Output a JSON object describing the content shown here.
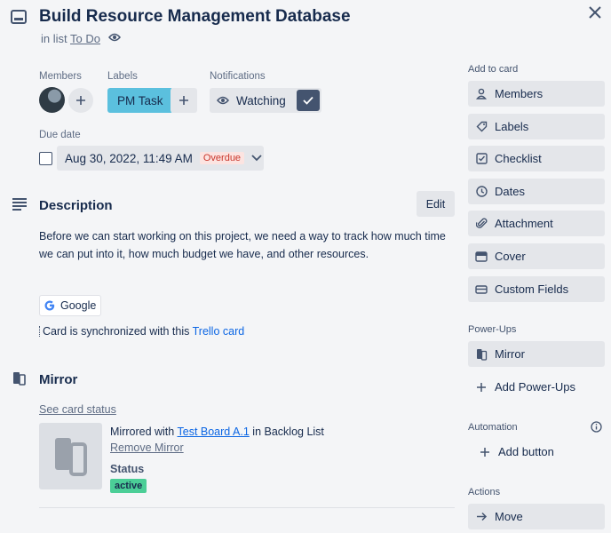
{
  "card": {
    "title": "Build Resource Management Database",
    "in_list_prefix": "in list",
    "list_name": "To Do"
  },
  "members": {
    "heading": "Members"
  },
  "labels": {
    "heading": "Labels",
    "items": [
      {
        "name": "PM Task",
        "color": "#5bc0de"
      }
    ]
  },
  "notifications": {
    "heading": "Notifications",
    "watch_label": "Watching"
  },
  "due_date": {
    "heading": "Due date",
    "value": "Aug 30, 2022, 11:49 AM",
    "status": "Overdue"
  },
  "description": {
    "heading": "Description",
    "edit_label": "Edit",
    "text": "Before we can start working on this project, we need a way to track how much time we can put into it, how much budget we have, and other resources."
  },
  "google_chip": {
    "label": "Google"
  },
  "sync": {
    "prefix": "Card is synchronized with this",
    "link": "Trello card"
  },
  "mirror": {
    "heading": "Mirror",
    "see_status": "See card status",
    "mirrored_prefix": "Mirrored with",
    "board_link": "Test Board A.1",
    "mirrored_suffix": "in Backlog List",
    "remove_label": "Remove Mirror",
    "status_heading": "Status",
    "status_value": "active"
  },
  "sidebar": {
    "add_to_card_heading": "Add to card",
    "add_to_card": [
      {
        "label": "Members",
        "icon": "person-icon"
      },
      {
        "label": "Labels",
        "icon": "tag-icon"
      },
      {
        "label": "Checklist",
        "icon": "checkbox-icon"
      },
      {
        "label": "Dates",
        "icon": "clock-icon"
      },
      {
        "label": "Attachment",
        "icon": "paperclip-icon"
      },
      {
        "label": "Cover",
        "icon": "card-icon"
      },
      {
        "label": "Custom Fields",
        "icon": "field-icon"
      }
    ],
    "powerups_heading": "Power-Ups",
    "powerups": [
      {
        "label": "Mirror",
        "icon": "mirror-icon"
      }
    ],
    "add_powerups_label": "Add Power-Ups",
    "automation_heading": "Automation",
    "add_button_label": "Add button",
    "actions_heading": "Actions",
    "actions": [
      {
        "label": "Move",
        "icon": "arrow-right-icon"
      }
    ]
  }
}
